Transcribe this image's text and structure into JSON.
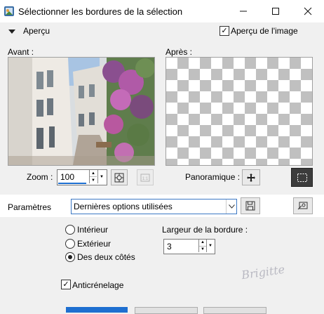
{
  "window": {
    "title": "Sélectionner les bordures de la sélection",
    "minimize_icon": "minimize-icon",
    "maximize_icon": "maximize-icon",
    "close_icon": "close-icon"
  },
  "preview_section": {
    "label": "Aperçu",
    "image_preview_label": "Aperçu de l'image",
    "image_preview_checked": true
  },
  "before": {
    "label": "Avant :"
  },
  "after": {
    "label": "Après :"
  },
  "zoom": {
    "label": "Zoom :",
    "value": "100"
  },
  "pan": {
    "label": "Panoramique :"
  },
  "parameters": {
    "label": "Paramètres",
    "preset_value": "Dernières options utilisées"
  },
  "border_side": {
    "options": [
      "Intérieur",
      "Extérieur",
      "Des deux côtés"
    ],
    "selected": "Des deux côtés"
  },
  "border_width": {
    "label": "Largeur de la bordure :",
    "value": "3"
  },
  "antialias": {
    "label": "Anticrénelage",
    "checked": true
  },
  "watermark": {
    "text": "Brigitte"
  },
  "colors": {
    "accent": "#1e6fd0",
    "background": "#f0f0f0"
  }
}
